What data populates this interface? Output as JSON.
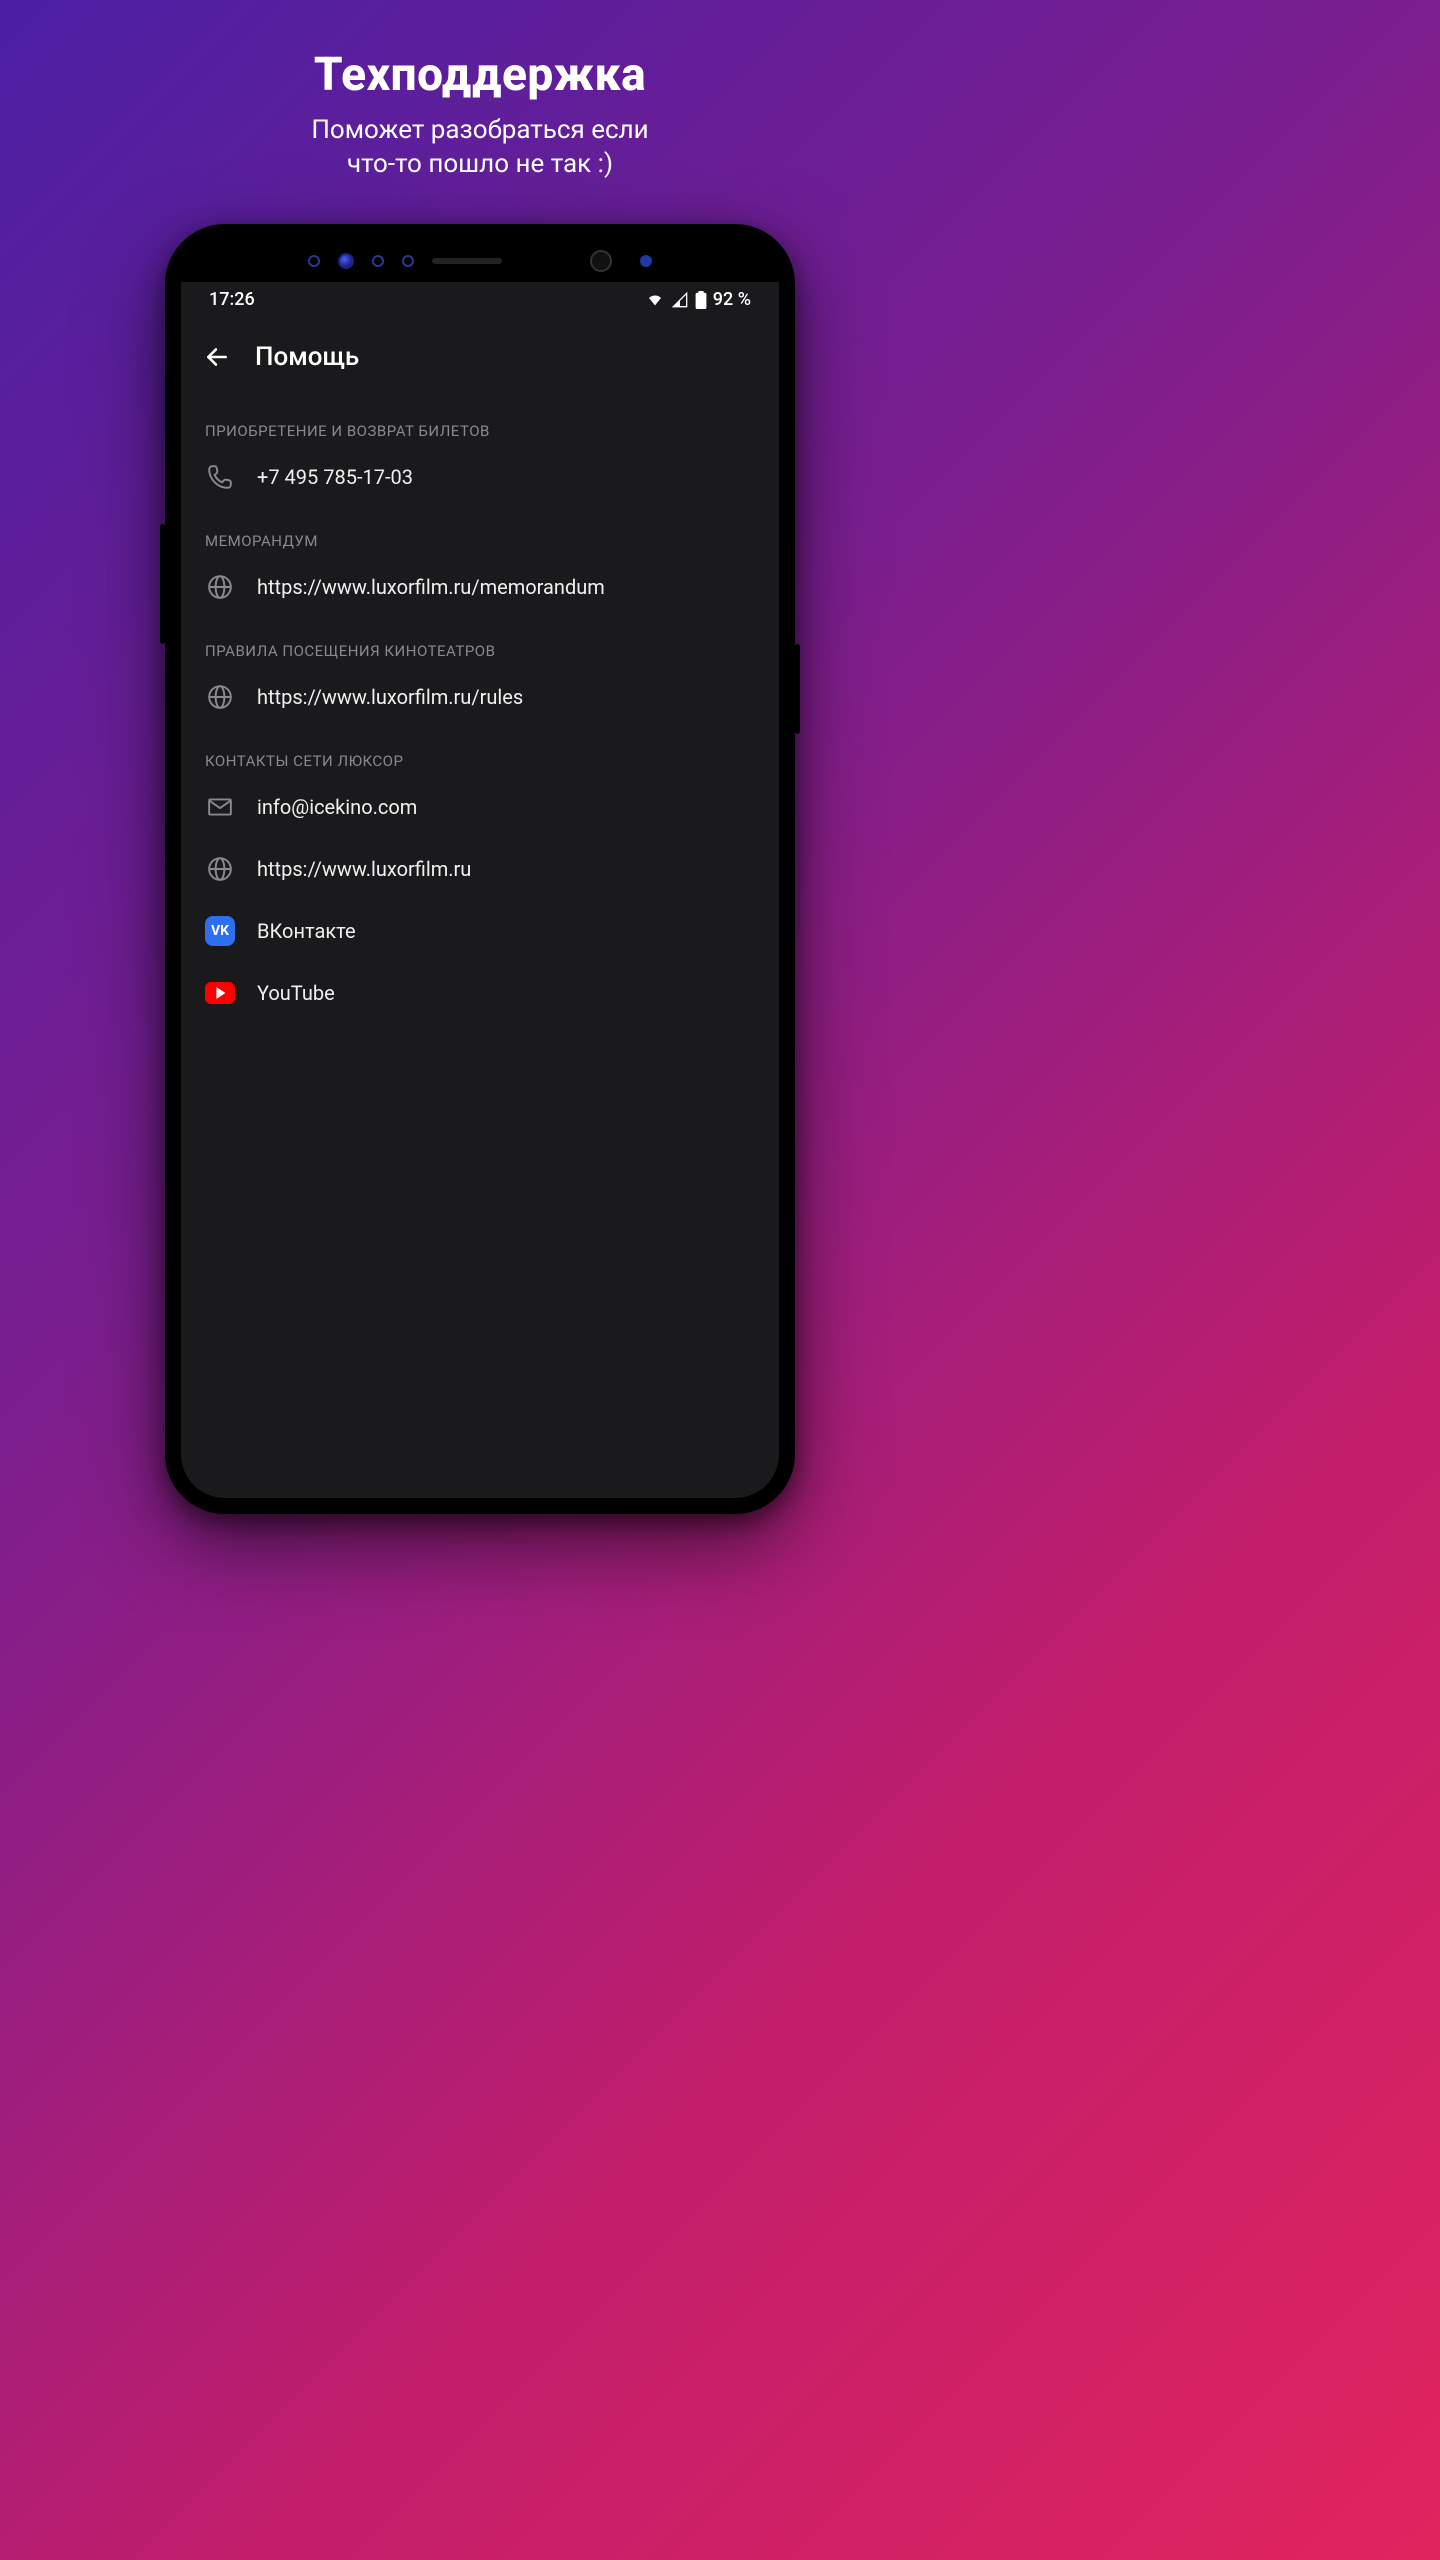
{
  "promo": {
    "title": "Техподдержка",
    "subtitle_line1": "Поможет разобраться если",
    "subtitle_line2": "что-то пошло не так :)"
  },
  "status": {
    "time": "17:26",
    "battery_text": "92 %"
  },
  "appbar": {
    "title": "Помощь"
  },
  "sections": [
    {
      "header": "ПРИОБРЕТЕНИЕ И ВОЗВРАТ БИЛЕТОВ",
      "items": [
        {
          "icon": "phone",
          "label": "+7 495 785-17-03"
        }
      ]
    },
    {
      "header": "МЕМОРАНДУМ",
      "items": [
        {
          "icon": "globe",
          "label": "https://www.luxorfilm.ru/memorandum"
        }
      ]
    },
    {
      "header": "ПРАВИЛА ПОСЕЩЕНИЯ КИНОТЕАТРОВ",
      "items": [
        {
          "icon": "globe",
          "label": "https://www.luxorfilm.ru/rules"
        }
      ]
    },
    {
      "header": "КОНТАКТЫ СЕТИ ЛЮКСОР",
      "items": [
        {
          "icon": "mail",
          "label": "info@icekino.com"
        },
        {
          "icon": "globe",
          "label": "https://www.luxorfilm.ru"
        },
        {
          "icon": "vk",
          "label": "ВКонтакте"
        },
        {
          "icon": "yt",
          "label": "YouTube"
        }
      ]
    }
  ]
}
